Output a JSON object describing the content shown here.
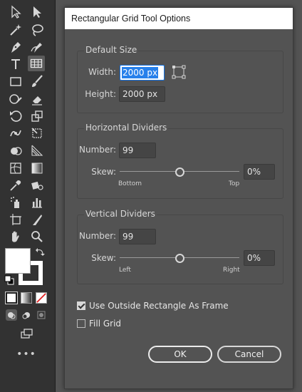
{
  "toolbar": {
    "tools": [
      "selection-tool",
      "direct-selection-tool",
      "magic-wand-tool",
      "lasso-tool",
      "pen-tool",
      "curvature-tool",
      "type-tool",
      "rectangular-grid-tool",
      "rectangle-tool",
      "paintbrush-tool",
      "shaper-tool",
      "eraser-tool",
      "rotate-tool",
      "scale-tool",
      "puppet-warp-tool",
      "free-transform-tool",
      "shape-builder-tool",
      "perspective-grid-tool",
      "mesh-tool",
      "gradient-tool",
      "eyedropper-tool",
      "live-paint-bucket-tool",
      "symbol-sprayer-tool",
      "column-graph-tool",
      "artboard-tool",
      "slice-tool",
      "hand-tool",
      "zoom-tool"
    ],
    "active_tool": "rectangular-grid-tool",
    "fill_color": "#ffffff",
    "stroke_color": "#ffffff",
    "more_label": "•••"
  },
  "dialog": {
    "title": "Rectangular Grid Tool Options",
    "default_size": {
      "heading": "Default Size",
      "width_label": "Width:",
      "width_value": "2000 px",
      "height_label": "Height:",
      "height_value": "2000 px"
    },
    "horizontal": {
      "heading": "Horizontal Dividers",
      "number_label": "Number:",
      "number_value": "99",
      "skew_label": "Skew:",
      "skew_value": "0%",
      "skew_fraction": 0.5,
      "left_end": "Bottom",
      "right_end": "Top"
    },
    "vertical": {
      "heading": "Vertical Dividers",
      "number_label": "Number:",
      "number_value": "99",
      "skew_label": "Skew:",
      "skew_value": "0%",
      "skew_fraction": 0.5,
      "left_end": "Left",
      "right_end": "Right"
    },
    "use_outside_label": "Use Outside Rectangle As Frame",
    "use_outside_checked": true,
    "fill_grid_label": "Fill Grid",
    "fill_grid_checked": false,
    "ok_label": "OK",
    "cancel_label": "Cancel"
  }
}
